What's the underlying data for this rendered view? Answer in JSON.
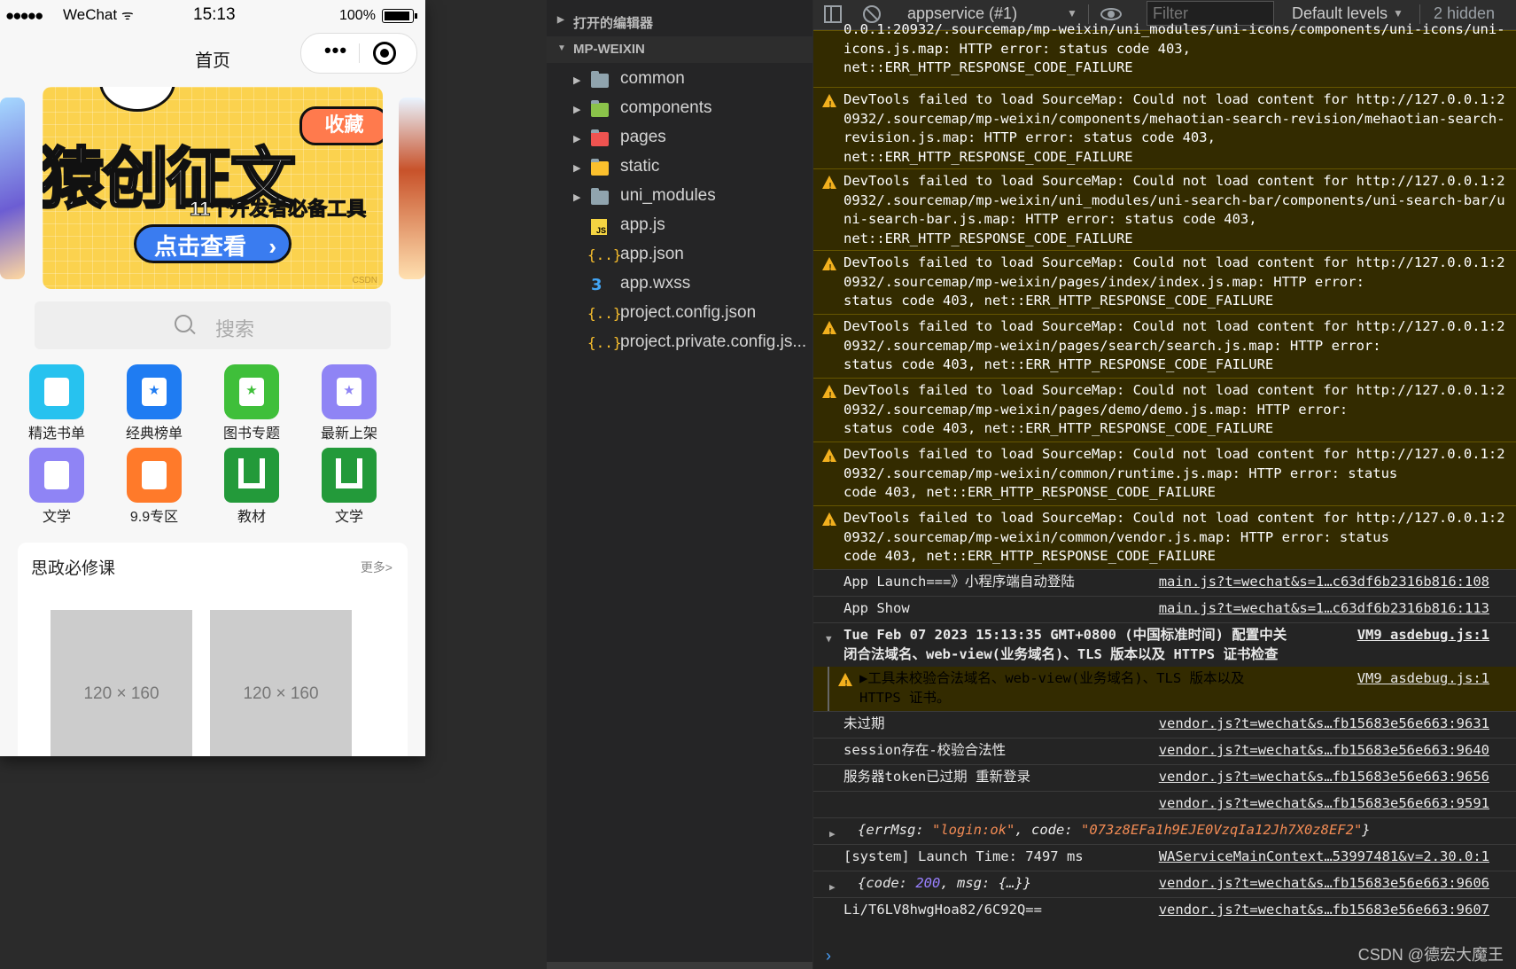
{
  "phone": {
    "statusbar": {
      "signal": "●●●●●",
      "carrier": "WeChat",
      "wifi": "ᯤ",
      "time": "15:13",
      "battery": "100%"
    },
    "nav_title": "首页",
    "capsule_dots": "•••",
    "banner": {
      "tag": "收藏",
      "headline": "猿创征文",
      "subline": "11个开发者必备工具",
      "cta": "点击查看",
      "cta_arrow": "›",
      "watermark": "CSDN"
    },
    "search_placeholder": "搜索",
    "grid": [
      {
        "label": "精选书单",
        "icon": "doc-icon",
        "color": "#27c2ef"
      },
      {
        "label": "经典榜单",
        "icon": "bookmark-star-icon",
        "color": "#1f7cf2"
      },
      {
        "label": "图书专题",
        "icon": "bookmark-star-icon",
        "color": "#3fbf3a"
      },
      {
        "label": "最新上架",
        "icon": "bookmark-star-icon",
        "color": "#8f84f5"
      },
      {
        "label": "文学",
        "icon": "chart-icon",
        "color": "#8f84f5"
      },
      {
        "label": "9.9专区",
        "icon": "book-icon",
        "color": "#ff7a2a"
      },
      {
        "label": "教材",
        "icon": "u-logo-icon",
        "color": "#239a3a"
      },
      {
        "label": "文学",
        "icon": "u-logo-icon",
        "color": "#239a3a"
      }
    ],
    "card": {
      "title": "思政必修课",
      "more": "更多>",
      "placeholders": [
        "120 × 160",
        "120 × 160"
      ]
    }
  },
  "explorer": {
    "open_editors": "打开的编辑器",
    "project": "MP-WEIXIN",
    "expand_collapsed": "▶",
    "expand_open": "▼",
    "items": [
      {
        "name": "common",
        "type": "folder",
        "color": "#90a4ae"
      },
      {
        "name": "components",
        "type": "folder",
        "color": "#8bc34a"
      },
      {
        "name": "pages",
        "type": "folder",
        "color": "#ef5350"
      },
      {
        "name": "static",
        "type": "folder",
        "color": "#fbc02d"
      },
      {
        "name": "uni_modules",
        "type": "folder",
        "color": "#90a4ae"
      },
      {
        "name": "app.js",
        "type": "js"
      },
      {
        "name": "app.json",
        "type": "json"
      },
      {
        "name": "app.wxss",
        "type": "css"
      },
      {
        "name": "project.config.json",
        "type": "json"
      },
      {
        "name": "project.private.config.js...",
        "type": "json"
      }
    ],
    "js_glyph": "JS",
    "json_glyph": "{..}",
    "css_glyph": "3"
  },
  "console": {
    "context": "appservice (#1)",
    "dropdown_arrow": "▼",
    "filter_placeholder": "Filter",
    "levels": "Default levels",
    "hidden": "2 hidden",
    "logs": [
      {
        "kind": "warn",
        "text": "0.0.1:20932/.sourcemap/mp-weixin/uni_modules/uni-icons/components/uni-icons/uni-icons.js.map: HTTP error: status code 403,\nnet::ERR_HTTP_RESPONSE_CODE_FAILURE"
      },
      {
        "kind": "warn",
        "text": "DevTools failed to load SourceMap: Could not load content for http://127.0.0.1:20932/.sourcemap/mp-weixin/components/mehaotian-search-revision/mehaotian-search-revision.js.map: HTTP error: status code 403,\nnet::ERR_HTTP_RESPONSE_CODE_FAILURE"
      },
      {
        "kind": "warn",
        "text": "DevTools failed to load SourceMap: Could not load content for http://127.0.0.1:20932/.sourcemap/mp-weixin/uni_modules/uni-search-bar/components/uni-search-bar/uni-search-bar.js.map: HTTP error: status code 403,\nnet::ERR_HTTP_RESPONSE_CODE_FAILURE"
      },
      {
        "kind": "warn",
        "text": "DevTools failed to load SourceMap: Could not load content for http://127.0.0.1:20932/.sourcemap/mp-weixin/pages/index/index.js.map: HTTP error:\nstatus code 403, net::ERR_HTTP_RESPONSE_CODE_FAILURE"
      },
      {
        "kind": "warn",
        "text": "DevTools failed to load SourceMap: Could not load content for http://127.0.0.1:20932/.sourcemap/mp-weixin/pages/search/search.js.map: HTTP error:\nstatus code 403, net::ERR_HTTP_RESPONSE_CODE_FAILURE"
      },
      {
        "kind": "warn",
        "text": "DevTools failed to load SourceMap: Could not load content for http://127.0.0.1:20932/.sourcemap/mp-weixin/pages/demo/demo.js.map: HTTP error:\nstatus code 403, net::ERR_HTTP_RESPONSE_CODE_FAILURE"
      },
      {
        "kind": "warn",
        "text": "DevTools failed to load SourceMap: Could not load content for http://127.0.0.1:20932/.sourcemap/mp-weixin/common/runtime.js.map: HTTP error: status\ncode 403, net::ERR_HTTP_RESPONSE_CODE_FAILURE"
      },
      {
        "kind": "warn",
        "text": "DevTools failed to load SourceMap: Could not load content for http://127.0.0.1:20932/.sourcemap/mp-weixin/common/vendor.js.map: HTTP error: status\ncode 403, net::ERR_HTTP_RESPONSE_CODE_FAILURE"
      },
      {
        "kind": "info",
        "text": "App Launch===》小程序端自动登陆",
        "src": "main.js?t=wechat&s=1…c63df6b2316b816:108"
      },
      {
        "kind": "info",
        "text": "App Show",
        "src": "main.js?t=wechat&s=1…c63df6b2316b816:113"
      },
      {
        "kind": "group",
        "text": "Tue Feb 07 2023 15:13:35 GMT+0800 (中国标准时间) 配置中关\n闭合法域名、web-view(业务域名)、TLS 版本以及 HTTPS 证书检查",
        "src": "VM9 asdebug.js:1"
      },
      {
        "kind": "nested",
        "text": "▶工具未校验合法域名、web-view(业务域名)、TLS 版本以及\nHTTPS 证书。",
        "src": "VM9 asdebug.js:1"
      },
      {
        "kind": "info",
        "text": "未过期",
        "src": "vendor.js?t=wechat&s…fb15683e56e663:9631"
      },
      {
        "kind": "info",
        "text": "session存在-校验合法性",
        "src": "vendor.js?t=wechat&s…fb15683e56e663:9640"
      },
      {
        "kind": "info",
        "text": "服务器token已过期 重新登录",
        "src": "vendor.js?t=wechat&s…fb15683e56e663:9656"
      },
      {
        "kind": "info",
        "text": "",
        "src": "vendor.js?t=wechat&s…fb15683e56e663:9591"
      },
      {
        "kind": "obj1",
        "key1": "errMsg",
        "val1": "\"login:ok\"",
        "key2": "code",
        "val2": "\"073z8EFa1h9EJE0VzqIa12Jh7X0z8EF2\""
      },
      {
        "kind": "info",
        "text": "[system] Launch Time: 7497 ms",
        "src": "WAServiceMainContext…53997481&v=2.30.0:1"
      },
      {
        "kind": "obj2",
        "key1": "code",
        "val1": "200",
        "key2": "msg",
        "val2": "{…}",
        "src": "vendor.js?t=wechat&s…fb15683e56e663:9606"
      },
      {
        "kind": "info",
        "text": "Li/T6LV8hwgHoa82/6C92Q==",
        "src": "vendor.js?t=wechat&s…fb15683e56e663:9607"
      }
    ],
    "prompt": "›",
    "watermark": "CSDN @德宏大魔王"
  }
}
